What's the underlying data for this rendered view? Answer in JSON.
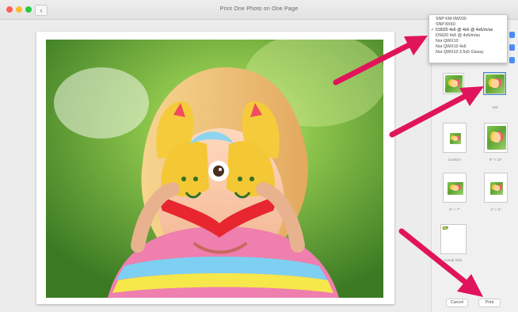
{
  "window": {
    "title": "Print One Photo on One Page",
    "back_label": "‹"
  },
  "menu": {
    "items": [
      {
        "label": "SNP KM-0W030",
        "checked": false
      },
      {
        "label": "SNP 8X60",
        "checked": false
      },
      {
        "label": "D3020 4x6 @ 4x6 @ 4x6/m/ax",
        "checked": true
      },
      {
        "label": "DS620 4x6 @ 4x6/m/ax",
        "checked": false
      },
      {
        "label": "Nor QWX10",
        "checked": false
      },
      {
        "label": "Nor QWX10 4x6",
        "checked": false
      },
      {
        "label": "Nor QWX10 3.5x5 Glossy",
        "checked": false
      }
    ],
    "check_symbol": "✓"
  },
  "thumbnails": [
    {
      "label": "",
      "selected": false
    },
    {
      "label": "4x5",
      "selected": true
    },
    {
      "label": "Custom",
      "selected": false
    },
    {
      "label": "8\" × 10\"",
      "selected": false
    },
    {
      "label": "5\" × 7\"",
      "selected": false
    },
    {
      "label": "4\" × 6\"",
      "selected": false
    },
    {
      "label": "Actual Size",
      "selected": false
    }
  ],
  "footer": {
    "cancel_label": "Cancel",
    "print_label": "Print"
  },
  "colors": {
    "accent": "#4a8ef2",
    "arrow": "#e0145a"
  }
}
